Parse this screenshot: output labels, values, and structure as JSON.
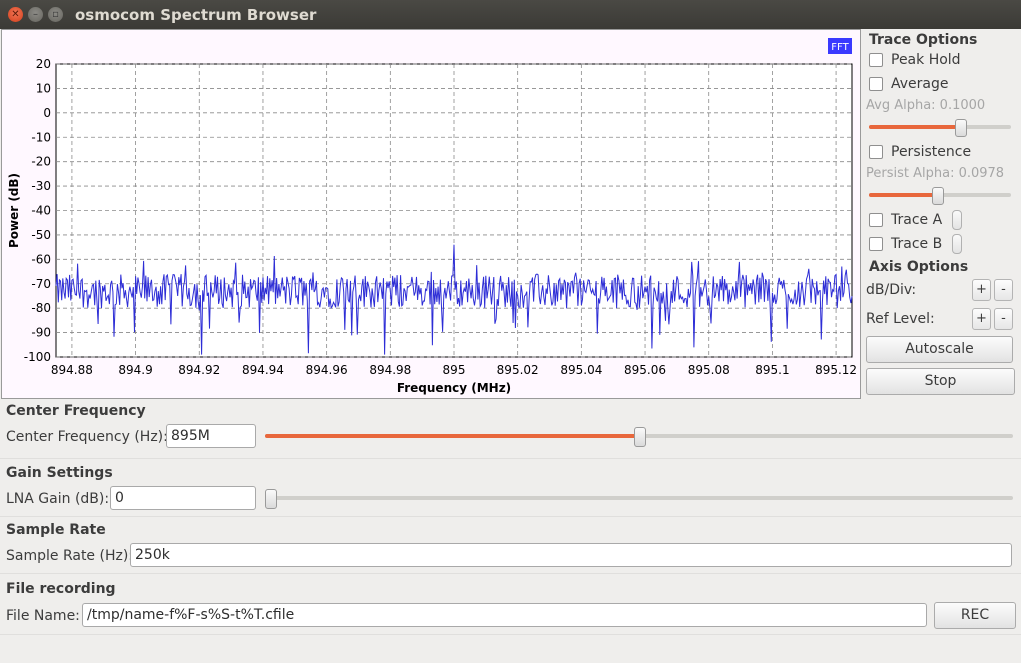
{
  "window": {
    "title": "osmocom Spectrum Browser"
  },
  "plot": {
    "fft_badge": "FFT",
    "badge_color": "#3a3aff",
    "trace_color": "#2d2dd6"
  },
  "chart_data": {
    "type": "line",
    "xlabel": "Frequency (MHz)",
    "ylabel": "Power (dB)",
    "xlim": [
      894.875,
      895.125
    ],
    "ylim": [
      -100,
      20
    ],
    "grid": true,
    "x_ticks": [
      "894.88",
      "894.9",
      "894.92",
      "894.94",
      "894.96",
      "894.98",
      "895",
      "895.02",
      "895.04",
      "895.06",
      "895.08",
      "895.1",
      "895.12"
    ],
    "y_ticks": [
      "20",
      "10",
      "0",
      "-10",
      "-20",
      "-30",
      "-40",
      "-50",
      "-60",
      "-70",
      "-80",
      "-90",
      "-100"
    ],
    "noise_floor": -73,
    "peak": {
      "x": 895.0,
      "y": -54
    }
  },
  "trace_options": {
    "title": "Trace Options",
    "peak_hold": "Peak Hold",
    "average": "Average",
    "avg_alpha": "Avg Alpha: 0.1000",
    "avg_alpha_value": 0.64,
    "persistence": "Persistence",
    "persist_alpha": "Persist Alpha: 0.0978",
    "persist_alpha_value": 0.48,
    "trace_a": "Trace A",
    "trace_b": "Trace B"
  },
  "axis_options": {
    "title": "Axis Options",
    "db_div": "dB/Div:",
    "ref_level": "Ref Level:",
    "plus": "+",
    "minus": "-",
    "autoscale": "Autoscale",
    "stop": "Stop"
  },
  "center_frequency": {
    "section": "Center Frequency",
    "label": "Center Frequency (Hz):",
    "value": "895M",
    "slider_value": 0.5
  },
  "gain": {
    "section": "Gain Settings",
    "label": "LNA Gain (dB):",
    "value": "0",
    "slider_value": 0.0
  },
  "sample_rate": {
    "section": "Sample Rate",
    "label": "Sample Rate (Hz):",
    "value": "250k"
  },
  "file_recording": {
    "section": "File recording",
    "label": "File Name:",
    "value": "/tmp/name-f%F-s%S-t%T.cfile",
    "rec": "REC"
  }
}
